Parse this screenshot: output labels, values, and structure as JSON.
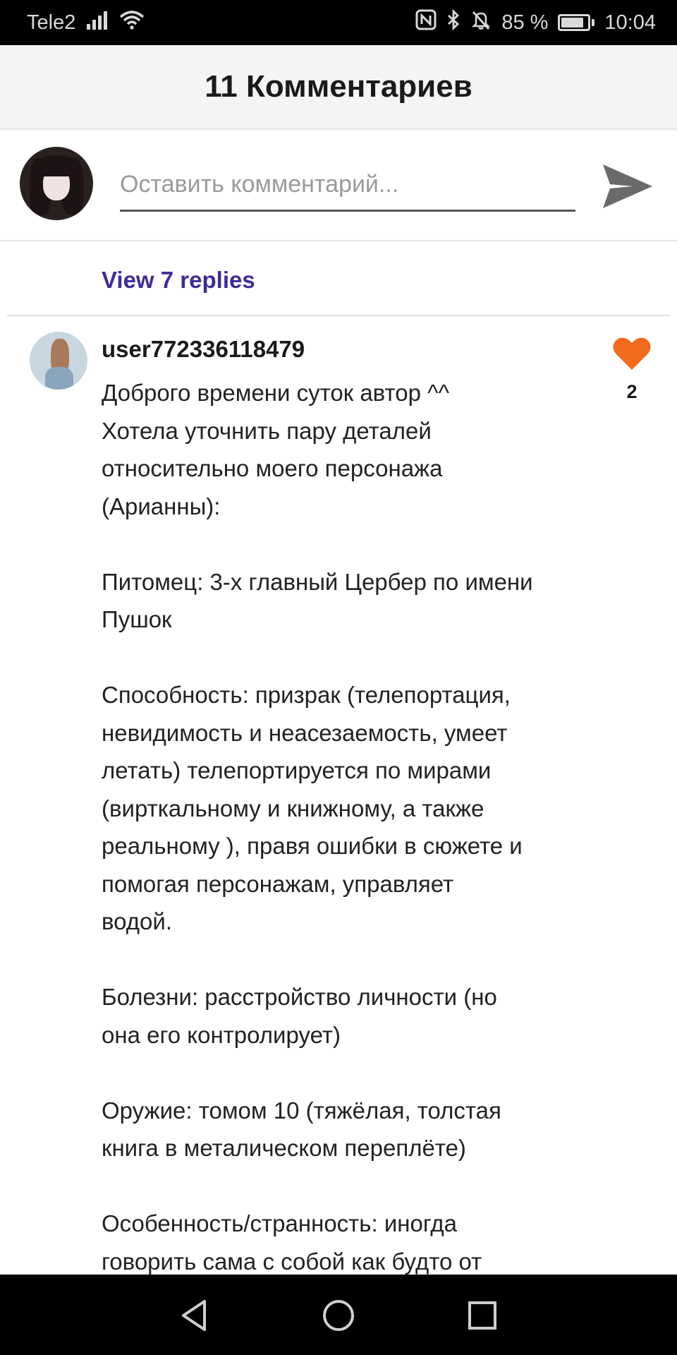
{
  "status_bar": {
    "carrier": "Tele2",
    "battery_percent_text": "85 %",
    "battery_level": 0.85,
    "time": "10:04",
    "icons": [
      "signal-icon",
      "wifi-icon",
      "nfc-icon",
      "bluetooth-icon",
      "mute-icon",
      "battery-icon"
    ]
  },
  "header": {
    "title": "11 Комментариев"
  },
  "comment_input": {
    "placeholder": "Оставить комментарий...",
    "value": "",
    "send_icon": "send-icon"
  },
  "thread": {
    "view_replies_label": "View 7 replies"
  },
  "comment": {
    "author": "user772336118479",
    "likes": "2",
    "like_icon": "heart-icon",
    "like_color": "#f26a1b",
    "body": "Доброго времени суток автор ^^\nХотела уточнить пару деталей\nотносительно моего персонажа\n(Арианны):\n\nПитомец: 3-х главный Цербер по имени\nПушок\n\nСпособность: призрак (телепортация,\nневидимость и неасезаемость, умеет\nлетать) телепортируется по мирами\n(вирткальному и книжному, а также\nреальному ), правя ошибки в сюжете и\nпомогая персонажам, управляет\nводой.\n\nБолезни: расстройство личности (но\nона его контролирует)\n\nОружие: томом 10 (тяжёлая, толстая\nкнига в металическом переплёте)\n\nОсобенность/странность: иногда\nговорить сама с собой как будто от"
  },
  "nav_bar": {
    "buttons": [
      "back-icon",
      "home-icon",
      "recents-icon"
    ]
  },
  "colors": {
    "accent_link": "#3a2d9c",
    "like": "#f26a1b",
    "header_bg": "#f4f4f4"
  }
}
